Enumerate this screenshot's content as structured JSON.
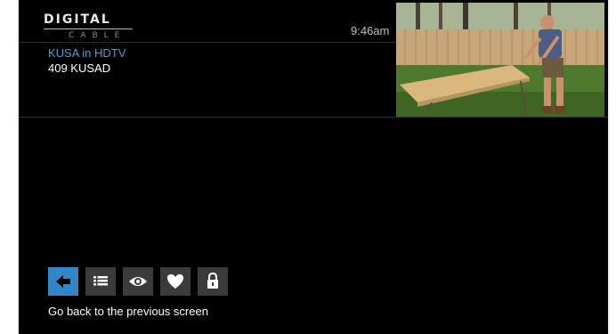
{
  "brand": {
    "name": "DIGITAL",
    "subtitle": "CABLE"
  },
  "clock": {
    "time": "9:46am"
  },
  "channel": {
    "name": "KUSA in HDTV",
    "number_line": "409 KUSAD"
  },
  "toolbar": {
    "buttons": [
      {
        "name": "back",
        "icon": "arrow-left-icon",
        "active": true
      },
      {
        "name": "guide",
        "icon": "list-icon",
        "active": false
      },
      {
        "name": "watch",
        "icon": "eye-icon",
        "active": false
      },
      {
        "name": "favorite",
        "icon": "heart-icon",
        "active": false
      },
      {
        "name": "lock",
        "icon": "lock-icon",
        "active": false
      }
    ]
  },
  "hint": {
    "text": "Go back to the previous screen"
  },
  "colors": {
    "accent": "#2f86c9",
    "channel_name": "#4a9fd8",
    "button_bg": "#3b3b3b",
    "background": "#000000"
  }
}
